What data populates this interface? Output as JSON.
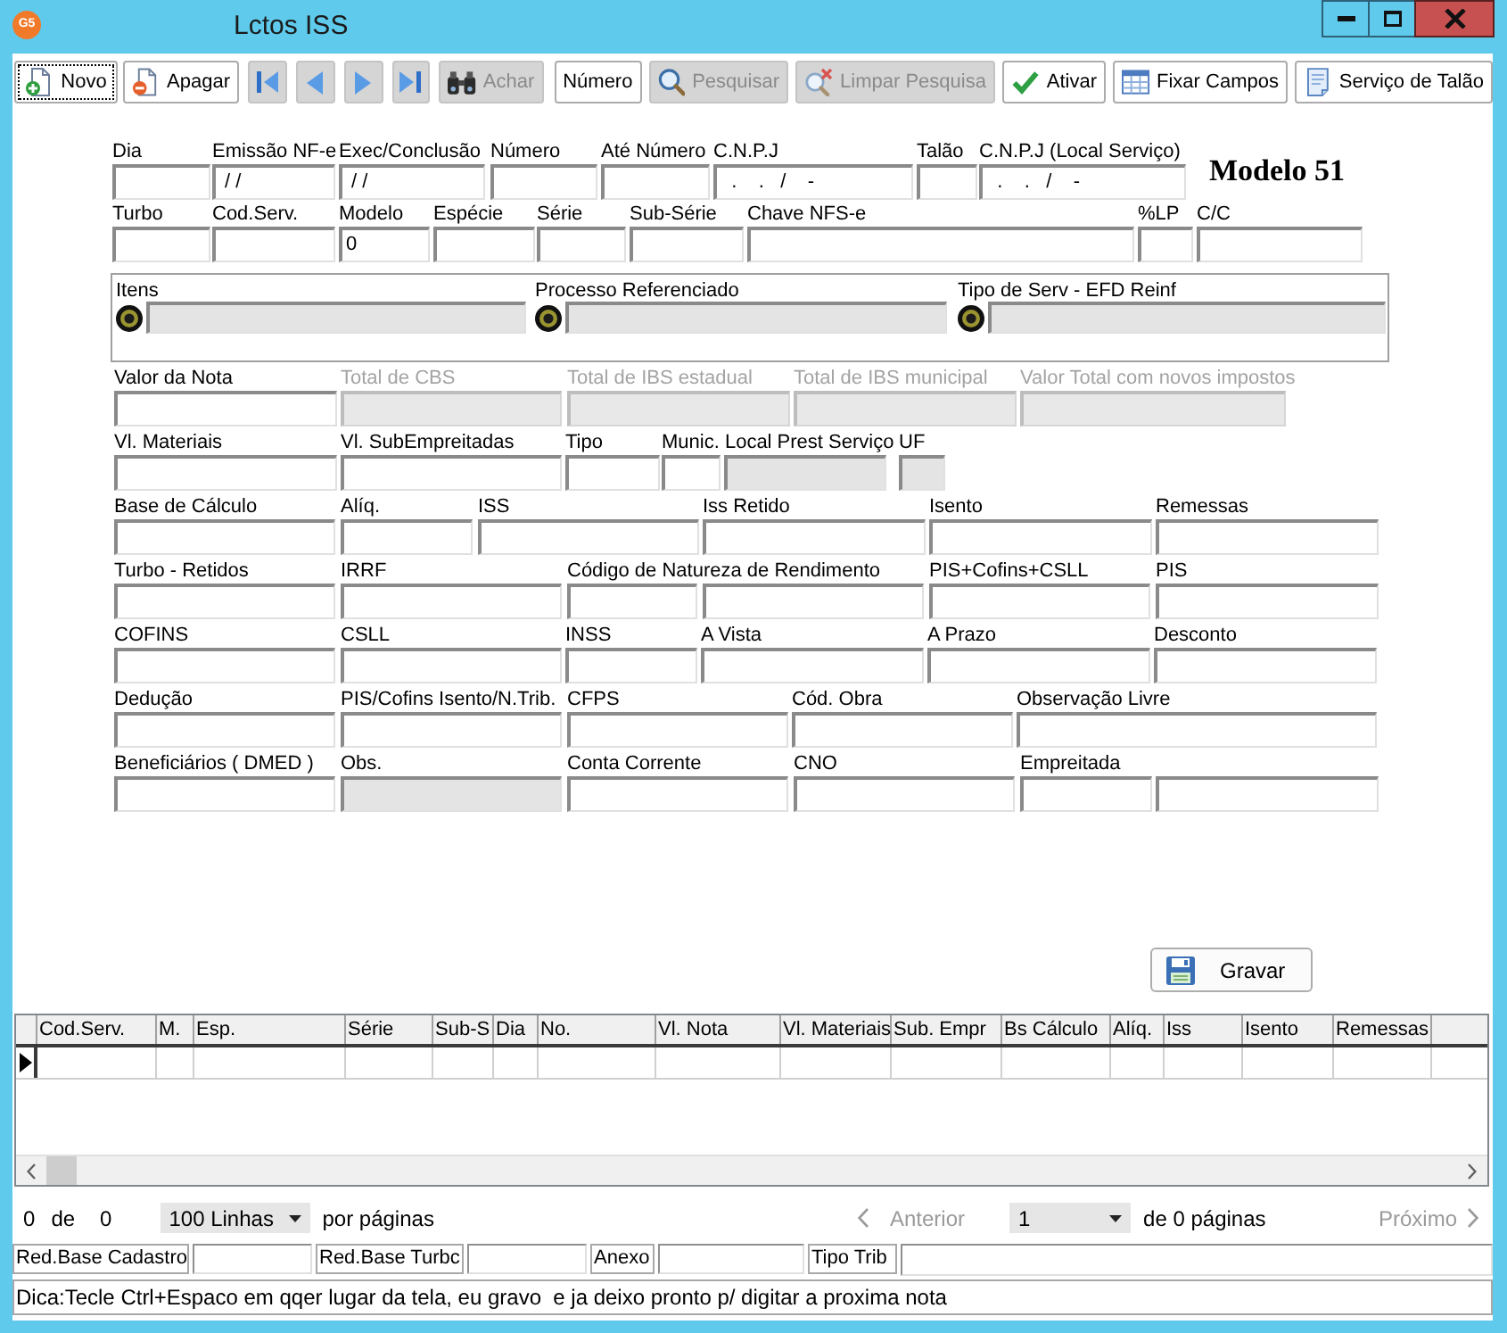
{
  "window": {
    "icon_text": "G5",
    "title": "Lctos ISS"
  },
  "toolbar": [
    {
      "kind": "new",
      "label": "Novo",
      "disabled": false,
      "focused": true
    },
    {
      "kind": "delete",
      "label": "Apagar",
      "disabled": false,
      "focused": false
    },
    {
      "kind": "first",
      "disabled": true,
      "focused": false
    },
    {
      "kind": "previous",
      "disabled": true,
      "focused": false
    },
    {
      "kind": "next",
      "disabled": true,
      "focused": false
    },
    {
      "kind": "last",
      "disabled": true,
      "focused": false
    },
    {
      "kind": "find",
      "label": "Achar",
      "disabled": true,
      "focused": false
    },
    {
      "kind": "number",
      "label": "Número",
      "disabled": false,
      "focused": false
    },
    {
      "kind": "search",
      "label": "Pesquisar",
      "disabled": true,
      "focused": false
    },
    {
      "kind": "clear_search",
      "label": "Limpar Pesquisa",
      "disabled": true,
      "focused": false
    },
    {
      "kind": "activate",
      "label": "Ativar",
      "disabled": false,
      "focused": false
    },
    {
      "kind": "fix_fields",
      "label": "Fixar Campos",
      "disabled": false,
      "focused": false
    },
    {
      "kind": "booklet",
      "label": "Serviço de Talão",
      "disabled": false,
      "focused": false
    }
  ],
  "form": {
    "caption": "Modelo 51",
    "top_rows": [
      {
        "fields": [
          {
            "label": "Dia",
            "disabled": false,
            "readonly": false
          },
          {
            "label": "Emissão NF-e",
            "value": " / /",
            "disabled": false,
            "readonly": false
          },
          {
            "label": "Exec/Conclusão",
            "value": " / /",
            "disabled": false,
            "readonly": false
          },
          {
            "label": "Número",
            "disabled": false,
            "readonly": false
          },
          {
            "label": "Até Número",
            "disabled": false,
            "readonly": false
          },
          {
            "label": "C.N.P.J",
            "value": "  .    .   /    -",
            "disabled": false,
            "readonly": false
          },
          {
            "label": "Talão",
            "disabled": false,
            "readonly": false
          },
          {
            "label": "C.N.P.J (Local Serviço)",
            "value": "  .    .   /    -",
            "disabled": false,
            "readonly": false
          }
        ]
      },
      {
        "fields": [
          {
            "label": "Turbo",
            "disabled": false,
            "readonly": false
          },
          {
            "label": "Cod.Serv.",
            "disabled": false,
            "readonly": false
          },
          {
            "label": "Modelo",
            "value": "0",
            "disabled": false,
            "readonly": false
          },
          {
            "label": "Espécie",
            "disabled": false,
            "readonly": false
          },
          {
            "label": "Série",
            "disabled": false,
            "readonly": false
          },
          {
            "label": "Sub-Série",
            "disabled": false,
            "readonly": false
          },
          {
            "label": "Chave NFS-e",
            "disabled": false,
            "readonly": false
          },
          {
            "label": "%LP",
            "disabled": false,
            "readonly": false
          },
          {
            "label": "C/C",
            "disabled": false,
            "readonly": false
          }
        ]
      }
    ],
    "references": [
      {
        "label": "Itens",
        "readonly": true
      },
      {
        "label": "Processo Referenciado",
        "readonly": true
      },
      {
        "label": "Tipo de Serv - EFD Reinf",
        "readonly": true
      }
    ],
    "rows": [
      {
        "fields": [
          {
            "label": "Valor da Nota",
            "disabled": false,
            "readonly": false
          },
          {
            "label": "Total de CBS",
            "disabled": true,
            "readonly": false
          },
          {
            "label": "Total de IBS estadual",
            "disabled": true,
            "readonly": false
          },
          {
            "label": "Total de IBS municipal",
            "disabled": true,
            "readonly": false
          },
          {
            "label": "Valor Total com novos impostos",
            "disabled": true,
            "readonly": false
          }
        ]
      },
      {
        "fields": [
          {
            "label": "Vl. Materiais",
            "disabled": false,
            "readonly": false
          },
          {
            "label": "Vl. SubEmpreitadas",
            "disabled": false,
            "readonly": false
          },
          {
            "label": "Tipo",
            "disabled": false,
            "readonly": false
          },
          {
            "label": "Munic. Local Prest Serviço",
            "disabled": false,
            "readonly": false
          },
          {
            "disabled": false,
            "readonly": true
          },
          {
            "label": "UF",
            "disabled": false,
            "readonly": true
          }
        ]
      },
      {
        "fields": [
          {
            "label": "Base de Cálculo",
            "disabled": false,
            "readonly": false
          },
          {
            "label": "Alíq.",
            "disabled": false,
            "readonly": false
          },
          {
            "label": "ISS",
            "disabled": false,
            "readonly": false
          },
          {
            "label": "Iss Retido",
            "disabled": false,
            "readonly": false
          },
          {
            "label": "Isento",
            "disabled": false,
            "readonly": false
          },
          {
            "label": "Remessas",
            "disabled": false,
            "readonly": false
          }
        ]
      },
      {
        "fields": [
          {
            "label": "Turbo - Retidos",
            "disabled": false,
            "readonly": false
          },
          {
            "label": "IRRF",
            "disabled": false,
            "readonly": false
          },
          {
            "label": "Código de Natureza de Rendimento",
            "disabled": false,
            "readonly": false
          },
          {
            "disabled": false,
            "readonly": false
          },
          {
            "label": "PIS+Cofins+CSLL",
            "disabled": false,
            "readonly": false
          },
          {
            "label": "PIS",
            "disabled": false,
            "readonly": false
          }
        ]
      },
      {
        "fields": [
          {
            "label": "COFINS",
            "disabled": false,
            "readonly": false
          },
          {
            "label": "CSLL",
            "disabled": false,
            "readonly": false
          },
          {
            "label": "INSS",
            "disabled": false,
            "readonly": false
          },
          {
            "label": "A Vista",
            "disabled": false,
            "readonly": false
          },
          {
            "label": "A Prazo",
            "disabled": false,
            "readonly": false
          },
          {
            "label": "Desconto",
            "disabled": false,
            "readonly": false
          }
        ]
      },
      {
        "fields": [
          {
            "label": "Dedução",
            "disabled": false,
            "readonly": false
          },
          {
            "label": "PIS/Cofins Isento/N.Trib.",
            "disabled": false,
            "readonly": false
          },
          {
            "label": "CFPS",
            "disabled": false,
            "readonly": false
          },
          {
            "label": "Cód. Obra",
            "disabled": false,
            "readonly": false
          },
          {
            "label": "Observação Livre",
            "disabled": false,
            "readonly": false
          }
        ]
      },
      {
        "fields": [
          {
            "label": "Beneficiários ( DMED )",
            "disabled": false,
            "readonly": false
          },
          {
            "label": "Obs.",
            "disabled": false,
            "readonly": true
          },
          {
            "label": "Conta Corrente",
            "disabled": false,
            "readonly": false
          },
          {
            "label": "CNO",
            "disabled": false,
            "readonly": false
          },
          {
            "label": "Empreitada",
            "disabled": false,
            "readonly": false
          },
          {
            "disabled": false,
            "readonly": false
          }
        ]
      }
    ]
  },
  "save_button": {
    "label": "Gravar"
  },
  "grid": {
    "columns": [
      "Cod.Serv.",
      "M.",
      "Esp.",
      "Série",
      "Sub-S",
      "Dia",
      "No.",
      "Vl. Nota",
      "Vl. Materiais",
      "Sub. Empr",
      "Bs Cálculo",
      "Alíq.",
      "Iss",
      "Isento",
      "Remessas"
    ],
    "rows": [
      {
        "selected": true
      }
    ]
  },
  "pager": {
    "shown": "0",
    "of": "de",
    "total": "0",
    "page_size": "100 Linhas",
    "per_page": "por páginas",
    "previous": {
      "label": "Anterior",
      "disabled": true
    },
    "page": "1",
    "of_pages": "de 0 páginas",
    "next": {
      "label": "Próximo",
      "disabled": true
    }
  },
  "footer": {
    "fields": [
      {
        "label": "Red.Base Cadastro"
      },
      {
        "label": "Red.Base Turbc"
      },
      {
        "label": "Anexo"
      },
      {
        "label": "Tipo Trib"
      }
    ],
    "hint": "Dica:Tecle Ctrl+Espaco em qqer lugar da tela, eu gravo  e ja deixo pronto p/ digitar a proxima nota"
  }
}
